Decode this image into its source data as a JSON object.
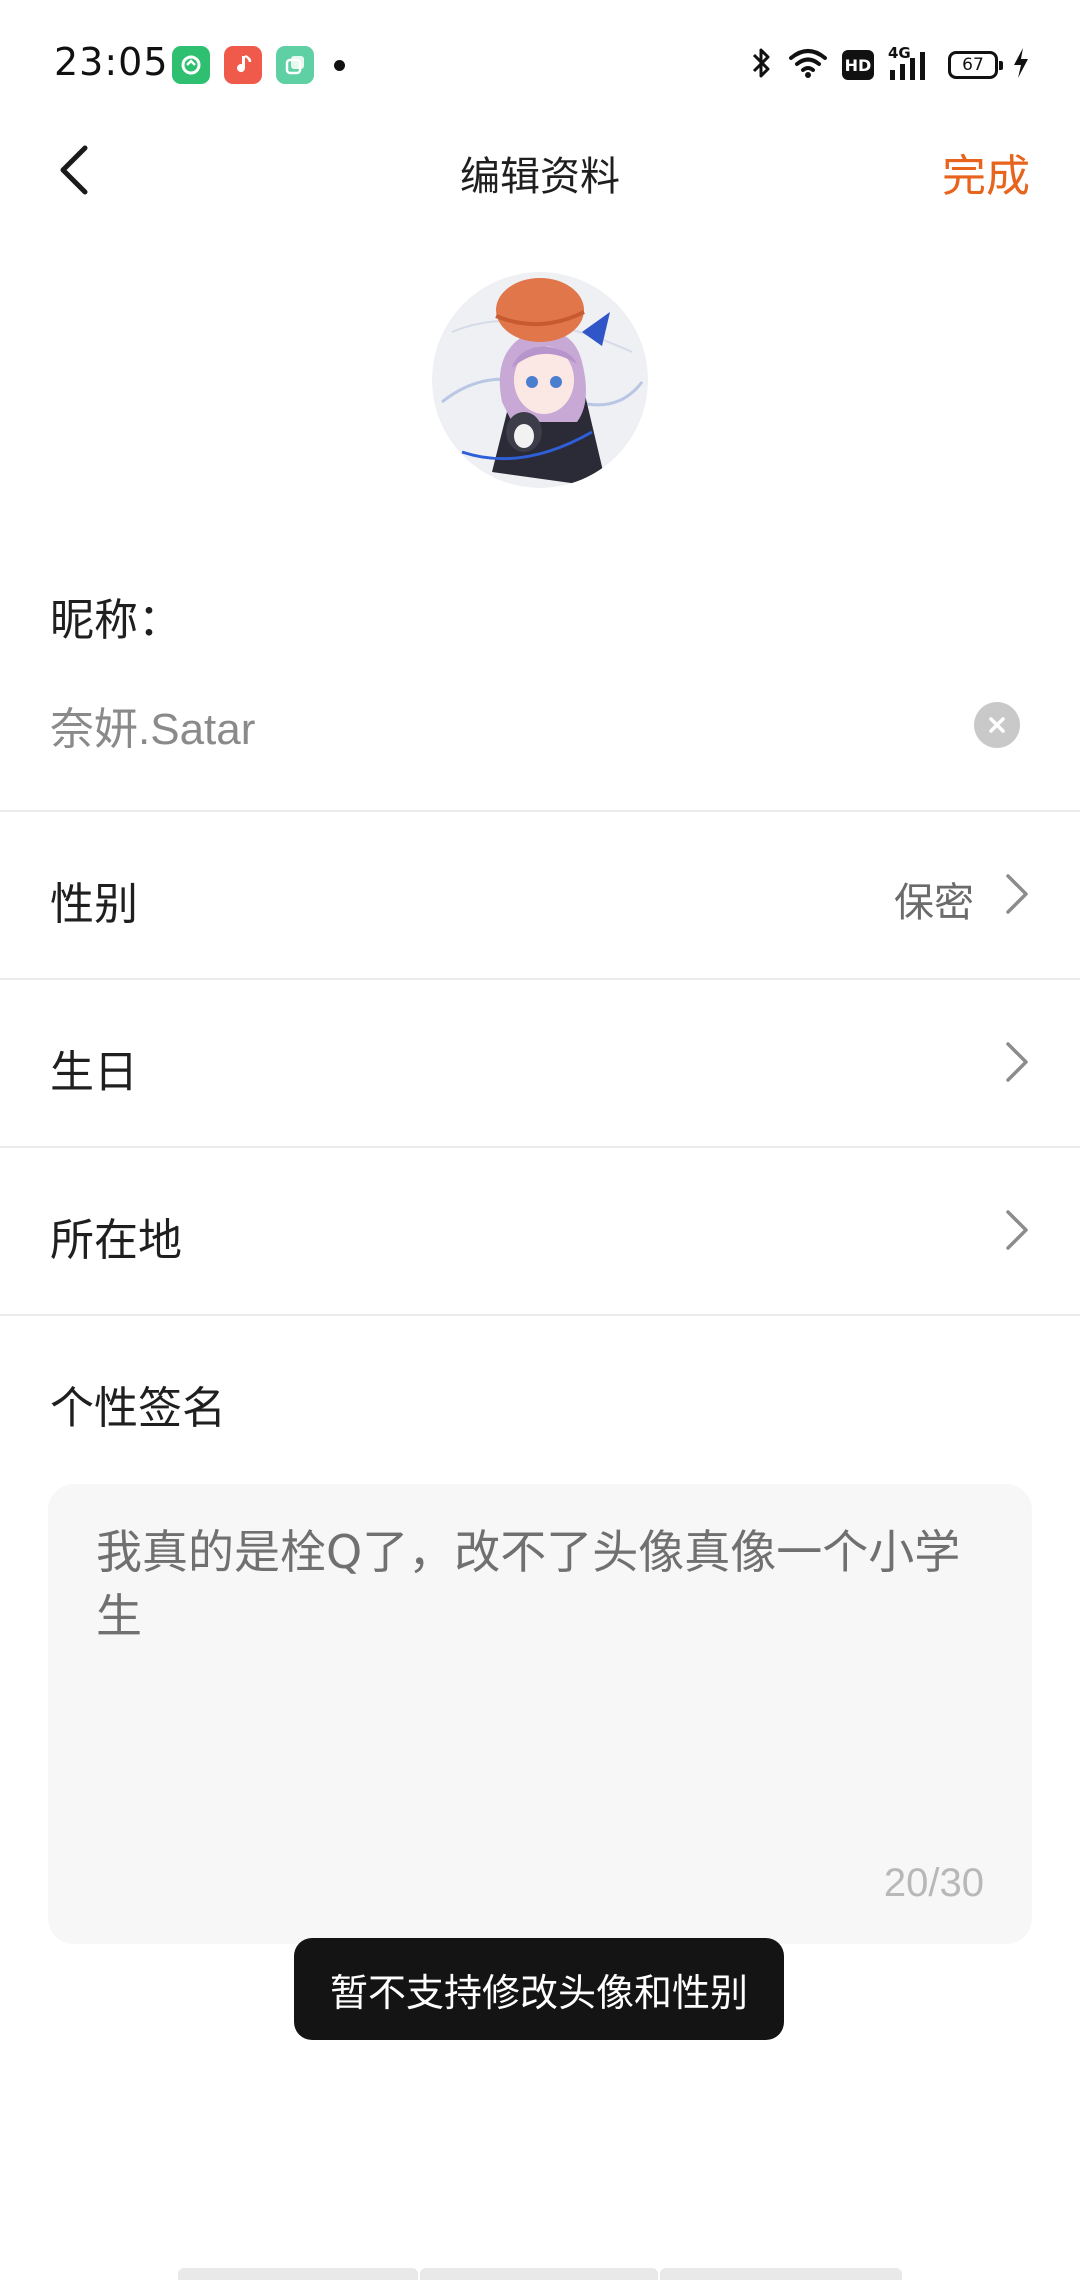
{
  "status_bar": {
    "time": "23:05",
    "notification_apps": [
      {
        "icon": "leaf-app-icon",
        "color": "#2fbf71"
      },
      {
        "icon": "music-app-icon",
        "color": "#f05a4a"
      },
      {
        "icon": "layers-app-icon",
        "color": "#5fd0a4"
      }
    ],
    "hd_label": "HD",
    "network_label": "4G",
    "battery_level": "67"
  },
  "nav": {
    "title": "编辑资料",
    "done_label": "完成"
  },
  "profile": {
    "nickname_label": "昵称：",
    "nickname_value": "奈妍.Satar",
    "gender_label": "性别",
    "gender_value": "保密",
    "birthday_label": "生日",
    "location_label": "所在地",
    "signature_label": "个性签名",
    "signature_text": "我真的是栓Q了，改不了头像真像一个小学生",
    "signature_counter": "20/30"
  },
  "toast": {
    "message": "暂不支持修改头像和性别"
  },
  "colors": {
    "accent": "#e8631c",
    "divider": "#ececec",
    "toast_bg": "#141414"
  }
}
